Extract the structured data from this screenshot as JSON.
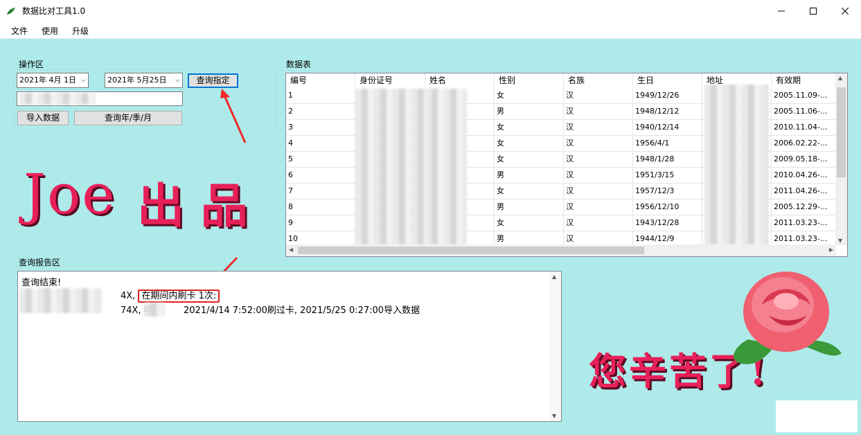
{
  "window": {
    "title": "数据比对工具1.0"
  },
  "menu": [
    "文件",
    "使用",
    "升级"
  ],
  "operation": {
    "label": "操作区",
    "start_date": "2021年  4月  1日",
    "end_date": "2021年  5月25日",
    "query_specified": "查询指定",
    "import_data": "导入数据",
    "query_period": "查询年/季/月"
  },
  "table": {
    "label": "数据表",
    "columns": [
      "编号",
      "身份证号",
      "姓名",
      "性别",
      "名族",
      "生日",
      "地址",
      "有效期"
    ],
    "rows": [
      [
        "1",
        "",
        "",
        "女",
        "汉",
        "1949/12/26",
        "",
        "2005.11.09-..."
      ],
      [
        "2",
        "",
        "",
        "男",
        "汉",
        "1948/12/12",
        "",
        "2005.11.06-..."
      ],
      [
        "3",
        "",
        "",
        "女",
        "汉",
        "1940/12/14",
        "",
        "2010.11.04-..."
      ],
      [
        "4",
        "",
        "",
        "女",
        "汉",
        "1956/4/1",
        "",
        "2006.02.22-..."
      ],
      [
        "5",
        "",
        "",
        "女",
        "汉",
        "1948/1/28",
        "",
        "2009.05.18-..."
      ],
      [
        "6",
        "",
        "",
        "男",
        "汉",
        "1951/3/15",
        "",
        "2010.04.26-..."
      ],
      [
        "7",
        "",
        "",
        "女",
        "汉",
        "1957/12/3",
        "",
        "2011.04.26-..."
      ],
      [
        "8",
        "",
        "",
        "男",
        "汉",
        "1956/12/10",
        "",
        "2005.12.29-..."
      ],
      [
        "9",
        "",
        "",
        "女",
        "汉",
        "1943/12/28",
        "",
        "2011.03.23-..."
      ],
      [
        "10",
        "",
        "",
        "男",
        "汉",
        "1944/12/9",
        "",
        "2011.03.23-..."
      ]
    ]
  },
  "logo": {
    "text_joe": "Joe",
    "text_cn": "出 品"
  },
  "report": {
    "label": "查询报告区",
    "line1": "查询结束!",
    "line2_suffix": "4X,",
    "line2_highlight": "在期间内刷卡 1次:",
    "line3_prefix": "74X, 李",
    "line3_rest": "2021/4/14 7:52:00刷过卡, 2021/5/25 0:27:00导入数据"
  },
  "greeting": "您辛苦了!",
  "colors": {
    "client_bg": "#aeeaea",
    "logo": "#e8205a",
    "highlight": "#e02020",
    "focus": "#0078d7"
  }
}
